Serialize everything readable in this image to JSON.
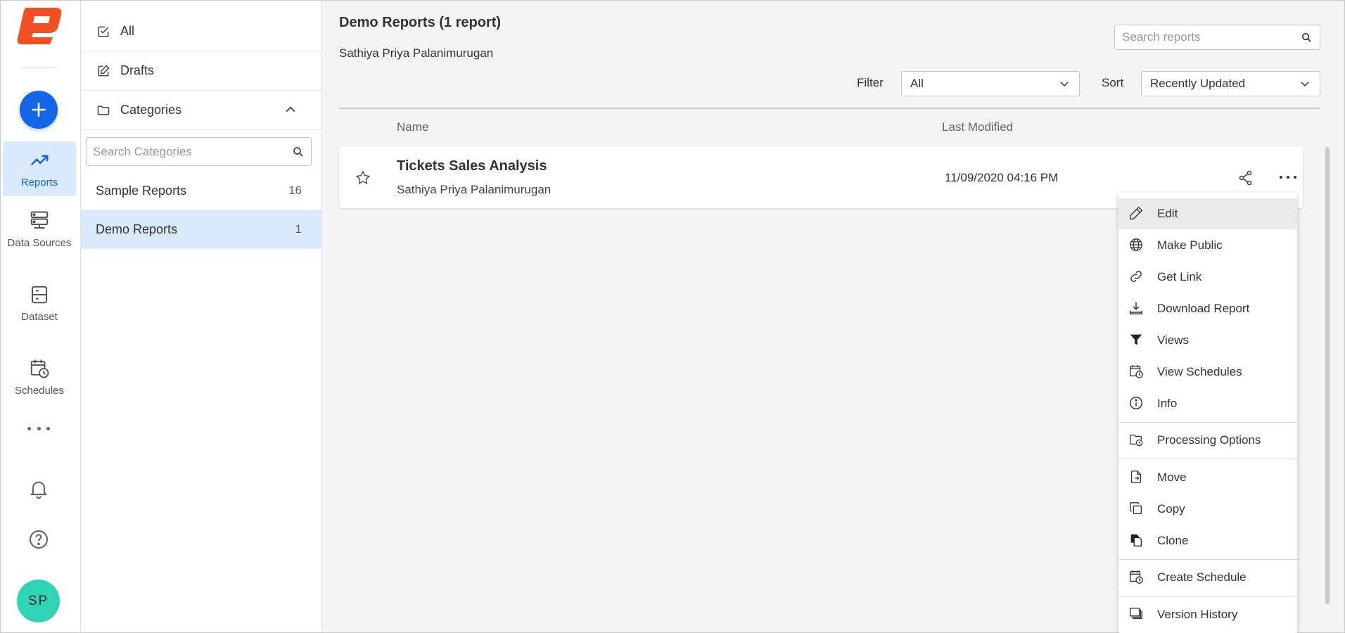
{
  "colors": {
    "accent": "#1565e8",
    "active_bg": "#dbe9fd",
    "logo": "#f25022",
    "avatar": "#2fd3b5"
  },
  "nav": {
    "items": [
      {
        "label": "Reports",
        "icon": "trending-up-icon"
      },
      {
        "label": "Data Sources",
        "icon": "server-icon"
      },
      {
        "label": "Dataset",
        "icon": "dataset-icon"
      },
      {
        "label": "Schedules",
        "icon": "calendar-clock-icon"
      }
    ],
    "avatar_initials": "SP"
  },
  "categories_panel": {
    "all_label": "All",
    "drafts_label": "Drafts",
    "categories_label": "Categories",
    "search_placeholder": "Search Categories",
    "items": [
      {
        "name": "Sample Reports",
        "count": "16"
      },
      {
        "name": "Demo Reports",
        "count": "1"
      }
    ]
  },
  "main": {
    "title": "Demo Reports (1 report)",
    "subtitle": "Sathiya Priya Palanimurugan",
    "search_placeholder": "Search reports",
    "filter_label": "Filter",
    "filter_value": "All",
    "sort_label": "Sort",
    "sort_value": "Recently Updated",
    "columns": {
      "name": "Name",
      "last_modified": "Last Modified"
    },
    "reports": [
      {
        "title": "Tickets Sales Analysis",
        "owner": "Sathiya Priya Palanimurugan",
        "modified": "11/09/2020 04:16 PM"
      }
    ]
  },
  "menu": {
    "items": [
      "Edit",
      "Make Public",
      "Get Link",
      "Download Report",
      "Views",
      "View Schedules",
      "Info",
      "Processing Options",
      "Move",
      "Copy",
      "Clone",
      "Create Schedule",
      "Version History"
    ]
  }
}
